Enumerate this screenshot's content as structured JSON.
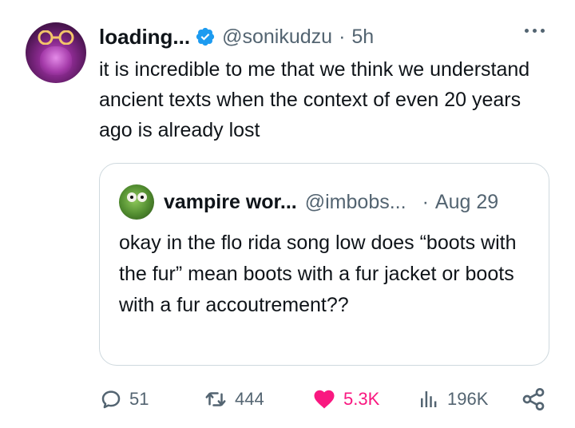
{
  "tweet": {
    "display_name": "loading...",
    "handle": "@sonikudzu",
    "separator": "·",
    "time": "5h",
    "text": "it is incredible to me that we think we understand ancient texts when the context of even 20 years ago is already lost"
  },
  "quoted": {
    "display_name": "vampire wor...",
    "handle": "@imbobs...",
    "separator": "·",
    "time": "Aug 29",
    "text": "okay in the flo rida song low does “boots with the fur” mean boots with a fur jacket or boots with a fur accoutrement??"
  },
  "actions": {
    "replies": "51",
    "reposts": "444",
    "likes": "5.3K",
    "views": "196K"
  },
  "icons": {
    "verified": "verified-badge-icon",
    "more": "more-dots-icon",
    "reply": "reply-icon",
    "repost": "repost-icon",
    "like": "heart-icon",
    "views": "views-icon",
    "share": "share-icon"
  },
  "colors": {
    "accent_blue": "#1d9bf0",
    "like_pink": "#f91880",
    "secondary_text": "#536471",
    "primary_text": "#0f1419",
    "border": "#cfd9de"
  }
}
